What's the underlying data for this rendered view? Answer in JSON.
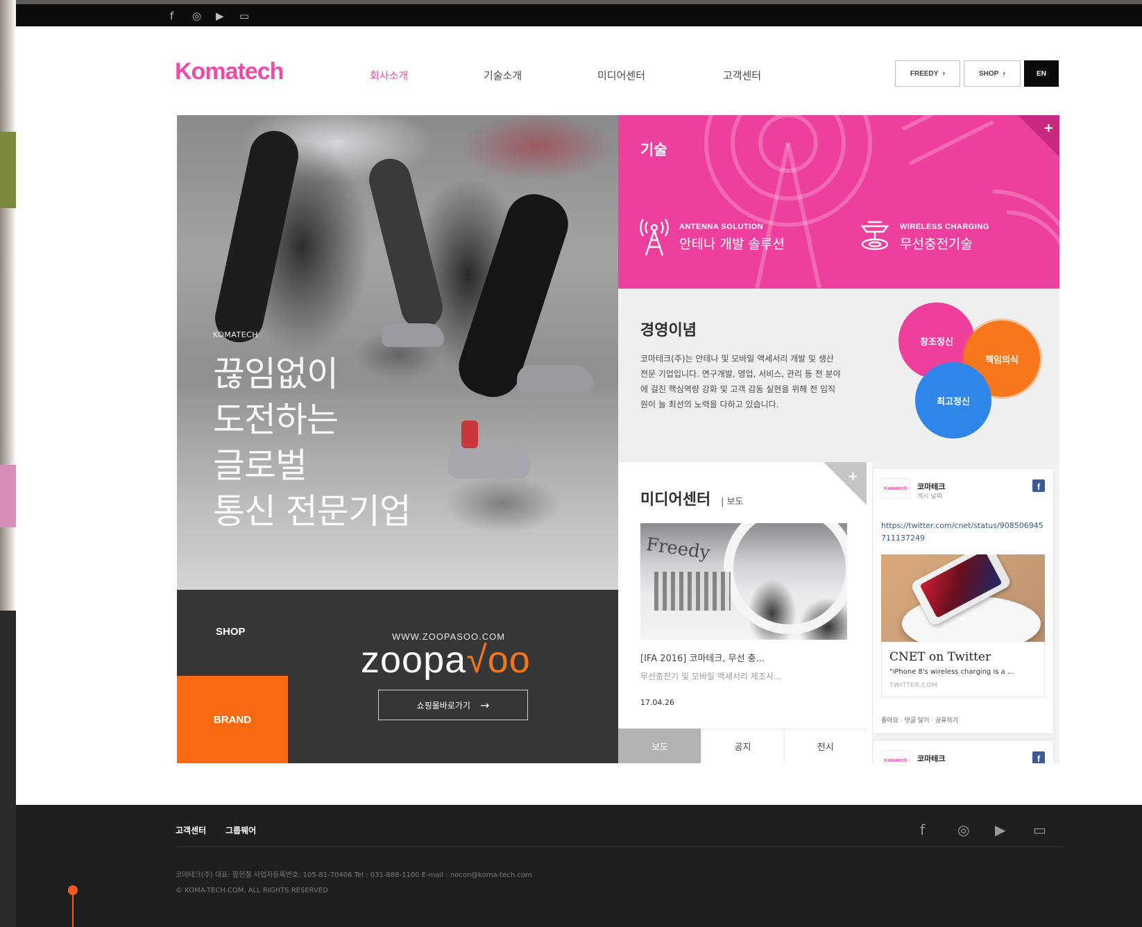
{
  "topbar": {
    "icons": [
      "facebook-icon",
      "instagram-icon",
      "youtube-icon",
      "chat-icon"
    ],
    "glyphs": [
      "f",
      "◎",
      "▶",
      "▭"
    ]
  },
  "header": {
    "logo": "Komatech",
    "nav": [
      "회사소개",
      "기술소개",
      "미디어센터",
      "고객센터"
    ],
    "buttons": {
      "freedy": "FREEDY",
      "shop": "SHOP",
      "lang": "EN"
    },
    "chevron": "›"
  },
  "hero": {
    "kicker": "KOMATECH",
    "headline": "끊임없이\n도전하는\n글로벌\n통신 전문기업"
  },
  "shop": {
    "label": "SHOP",
    "brand_box": "BRAND",
    "url": "WWW.ZOOPASOO.COM",
    "brand_pre": "zoopa",
    "brand_accent": "√oo",
    "go_label": "쇼핑몰바로가기",
    "go_arrow": "→"
  },
  "tech": {
    "title": "기술",
    "plus": "+",
    "items": [
      {
        "en": "ANTENNA SOLUTION",
        "ko": "안테나 개발 솔루션",
        "icon": "antenna-icon"
      },
      {
        "en": "WIRELESS CHARGING",
        "ko": "무선충전기술",
        "icon": "wireless-charging-icon"
      }
    ]
  },
  "philosophy": {
    "title": "경영이념",
    "body": "코마테크(주)는 안테나 및 모바일 액세서리 개발 및 생산 전문 기업입니다. 연구개발, 영업, 서비스, 관리 등 전 분야에 걸친 핵심역량 강화 및 고객 감동 실현을 위해 전 임직원이 늘 최선의 노력을 다하고 있습니다.",
    "circles": [
      "창조정신",
      "책임의식",
      "최고정신"
    ],
    "colors": {
      "pink": "#ee3f9c",
      "orange": "#f7771c",
      "blue": "#2f86e8"
    }
  },
  "media": {
    "title": "미디어센터",
    "subtitle": "| 보도",
    "plus": "+",
    "photo_sign": "Freedy",
    "headline": "[IFA 2016] 코마테크, 무선 충...",
    "desc": "무선충전기 및 모바일 액세서리 제조사...",
    "date": "17.04.26",
    "tabs": [
      "보도",
      "공지",
      "전시"
    ],
    "active_tab": "보도"
  },
  "feed": {
    "posts": [
      {
        "avatar": "Komatech",
        "name": "코마테크",
        "sub": "게시 날짜",
        "fb": "f",
        "link": "https://twitter.com/cnet/status/908506945711137249",
        "card_title": "CNET on Twitter",
        "card_text": "\"iPhone 8's wireless charging is a ...",
        "card_source": "TWITTER.COM",
        "actions": "좋아요 · 댓글 달기 · 공유하기"
      },
      {
        "avatar": "Komatech",
        "name": "코마테크",
        "fb": "f"
      }
    ]
  },
  "footer": {
    "links": [
      "고객센터",
      "그룹웨어"
    ],
    "icons": [
      "facebook-icon",
      "instagram-icon",
      "youtube-icon",
      "chat-icon"
    ],
    "glyphs": [
      "f",
      "◎",
      "▶",
      "▭"
    ],
    "info": "코마테크(주)   대표: 함현철   사업자등록번호: 105-81-70406   Tel : 031-888-1100   E-mail : nocon@koma-tech.com",
    "copyright": "© KOMA-TECH.COM. ALL RIGHTS RESERVED"
  }
}
